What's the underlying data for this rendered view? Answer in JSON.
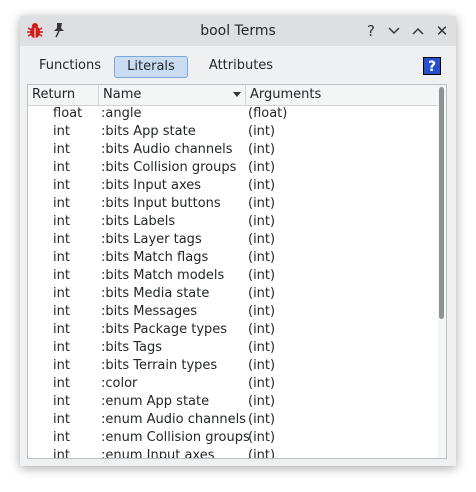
{
  "window": {
    "title": "bool Terms",
    "app_icon": "bug-icon",
    "buttons": [
      "help-icon",
      "minimize-icon",
      "maximize-icon",
      "close-icon"
    ],
    "help_glyph": "?",
    "close_glyph": "✕"
  },
  "tabs": [
    {
      "label": "Functions",
      "active": false
    },
    {
      "label": "Literals",
      "active": true
    },
    {
      "label": "Attributes",
      "active": false
    }
  ],
  "help_button": {
    "label": "?"
  },
  "table": {
    "headers": [
      "Return",
      "Name",
      "Arguments"
    ],
    "sorted_column": "Name",
    "rows": [
      {
        "ret": "float",
        "name": ":angle",
        "args": "(float)"
      },
      {
        "ret": "int",
        "name": ":bits App state",
        "args": "(int)"
      },
      {
        "ret": "int",
        "name": ":bits Audio channels",
        "args": "(int)"
      },
      {
        "ret": "int",
        "name": ":bits Collision groups",
        "args": "(int)"
      },
      {
        "ret": "int",
        "name": ":bits Input axes",
        "args": "(int)"
      },
      {
        "ret": "int",
        "name": ":bits Input buttons",
        "args": "(int)"
      },
      {
        "ret": "int",
        "name": ":bits Labels",
        "args": "(int)"
      },
      {
        "ret": "int",
        "name": ":bits Layer tags",
        "args": "(int)"
      },
      {
        "ret": "int",
        "name": ":bits Match flags",
        "args": "(int)"
      },
      {
        "ret": "int",
        "name": ":bits Match models",
        "args": "(int)"
      },
      {
        "ret": "int",
        "name": ":bits Media state",
        "args": "(int)"
      },
      {
        "ret": "int",
        "name": ":bits Messages",
        "args": "(int)"
      },
      {
        "ret": "int",
        "name": ":bits Package types",
        "args": "(int)"
      },
      {
        "ret": "int",
        "name": ":bits Tags",
        "args": "(int)"
      },
      {
        "ret": "int",
        "name": ":bits Terrain types",
        "args": "(int)"
      },
      {
        "ret": "int",
        "name": ":color",
        "args": "(int)"
      },
      {
        "ret": "int",
        "name": ":enum App state",
        "args": "(int)"
      },
      {
        "ret": "int",
        "name": ":enum Audio channels",
        "args": "(int)"
      },
      {
        "ret": "int",
        "name": ":enum Collision groups",
        "args": "(int)"
      },
      {
        "ret": "int",
        "name": ":enum Input axes",
        "args": "(int)"
      }
    ]
  },
  "colors": {
    "tab_active_bg": "#c9dcf2",
    "help_button_bg": "#2950cc",
    "app_icon_red": "#d11a1a"
  }
}
